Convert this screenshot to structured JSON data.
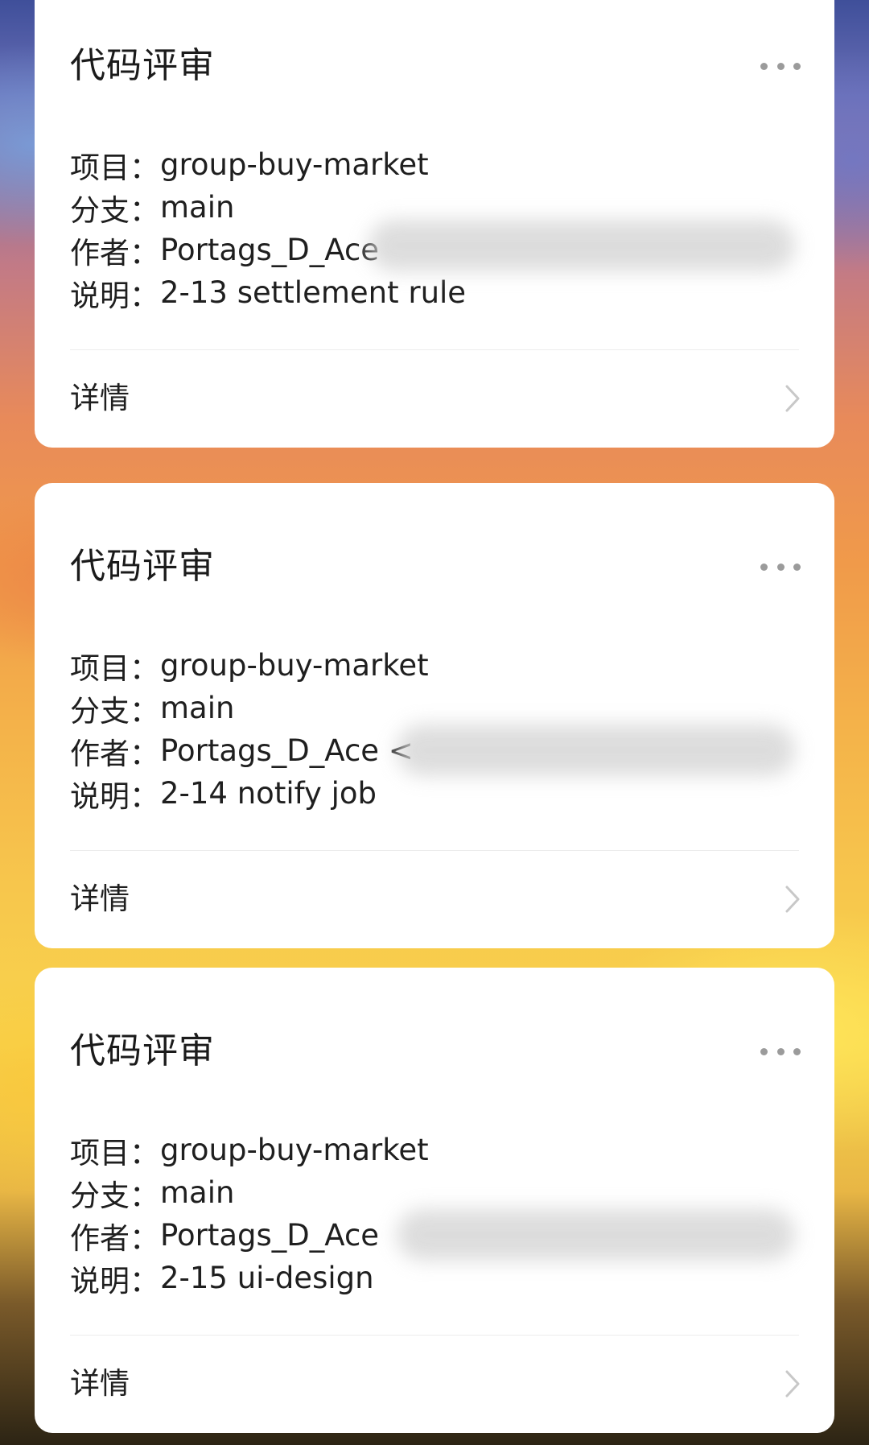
{
  "cards": [
    {
      "title": "代码评审",
      "fields": [
        {
          "label": "项目：",
          "value": "group-buy-market"
        },
        {
          "label": "分支：",
          "value": "main"
        },
        {
          "label": "作者：",
          "value": "Portags_D_Ace"
        },
        {
          "label": "说明：",
          "value": "2-13 settlement rule"
        }
      ],
      "details_label": "详情"
    },
    {
      "title": "代码评审",
      "fields": [
        {
          "label": "项目：",
          "value": "group-buy-market"
        },
        {
          "label": "分支：",
          "value": "main"
        },
        {
          "label": "作者：",
          "value": "Portags_D_Ace <"
        },
        {
          "label": "说明：",
          "value": "2-14 notify job"
        }
      ],
      "details_label": "详情"
    },
    {
      "title": "代码评审",
      "fields": [
        {
          "label": "项目：",
          "value": "group-buy-market"
        },
        {
          "label": "分支：",
          "value": "main"
        },
        {
          "label": "作者：",
          "value": "Portags_D_Ace"
        },
        {
          "label": "说明：",
          "value": "2-15 ui-design"
        }
      ],
      "details_label": "详情"
    }
  ],
  "icons": {
    "more": "more-horizontal-icon",
    "chevron": "chevron-right-icon"
  },
  "colors": {
    "card_background": "#ffffff",
    "text_primary": "#1b1b1b",
    "icon_gray": "#9b9b9b",
    "divider": "#ececec"
  }
}
